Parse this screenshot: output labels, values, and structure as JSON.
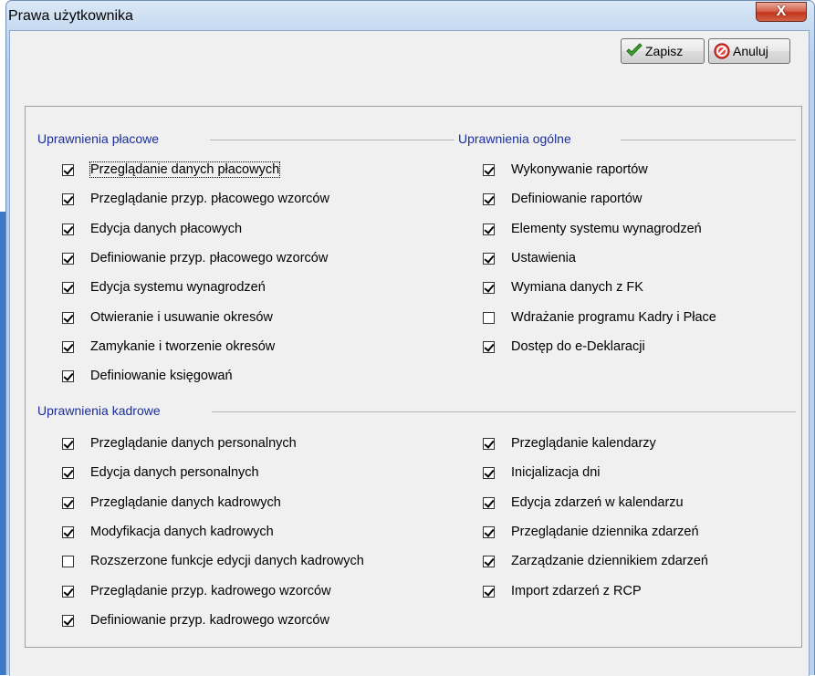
{
  "window": {
    "title": "Prawa użytkownika",
    "close_label": "X"
  },
  "toolbar": {
    "save_label": "Zapisz",
    "cancel_label": "Anuluj"
  },
  "groups": {
    "placowe": {
      "title": "Uprawnienia płacowe",
      "items": [
        {
          "label": "Przeglądanie danych płacowych",
          "checked": true
        },
        {
          "label": "Przeglądanie przyp. płacowego wzorców",
          "checked": true
        },
        {
          "label": "Edycja danych płacowych",
          "checked": true
        },
        {
          "label": "Definiowanie przyp. płacowego wzorców",
          "checked": true
        },
        {
          "label": "Edycja systemu wynagrodzeń",
          "checked": true
        },
        {
          "label": "Otwieranie i usuwanie okresów",
          "checked": true
        },
        {
          "label": "Zamykanie i tworzenie okresów",
          "checked": true
        },
        {
          "label": "Definiowanie księgowań",
          "checked": true
        }
      ]
    },
    "ogolne": {
      "title": "Uprawnienia ogólne",
      "items": [
        {
          "label": "Wykonywanie raportów",
          "checked": true
        },
        {
          "label": "Definiowanie raportów",
          "checked": true
        },
        {
          "label": "Elementy systemu wynagrodzeń",
          "checked": true
        },
        {
          "label": "Ustawienia",
          "checked": true
        },
        {
          "label": "Wymiana danych z FK",
          "checked": true
        },
        {
          "label": "Wdrażanie programu Kadry i Płace",
          "checked": false
        },
        {
          "label": "Dostęp do e-Deklaracji",
          "checked": true
        }
      ]
    },
    "kadrowe": {
      "title": "Uprawnienia kadrowe",
      "items_left": [
        {
          "label": "Przeglądanie danych personalnych",
          "checked": true
        },
        {
          "label": "Edycja danych personalnych",
          "checked": true
        },
        {
          "label": "Przeglądanie danych kadrowych",
          "checked": true
        },
        {
          "label": "Modyfikacja danych kadrowych",
          "checked": true
        },
        {
          "label": "Rozszerzone funkcje edycji danych kadrowych",
          "checked": false
        },
        {
          "label": "Przeglądanie przyp. kadrowego wzorców",
          "checked": true
        },
        {
          "label": "Definiowanie przyp. kadrowego wzorców",
          "checked": true
        }
      ],
      "items_right": [
        {
          "label": "Przeglądanie kalendarzy",
          "checked": true
        },
        {
          "label": "Inicjalizacja dni",
          "checked": true
        },
        {
          "label": "Edycja zdarzeń w kalendarzu",
          "checked": true
        },
        {
          "label": "Przeglądanie dziennika zdarzeń",
          "checked": true
        },
        {
          "label": "Zarządzanie dziennikiem zdarzeń",
          "checked": true
        },
        {
          "label": "Import zdarzeń z RCP",
          "checked": true
        }
      ]
    }
  }
}
